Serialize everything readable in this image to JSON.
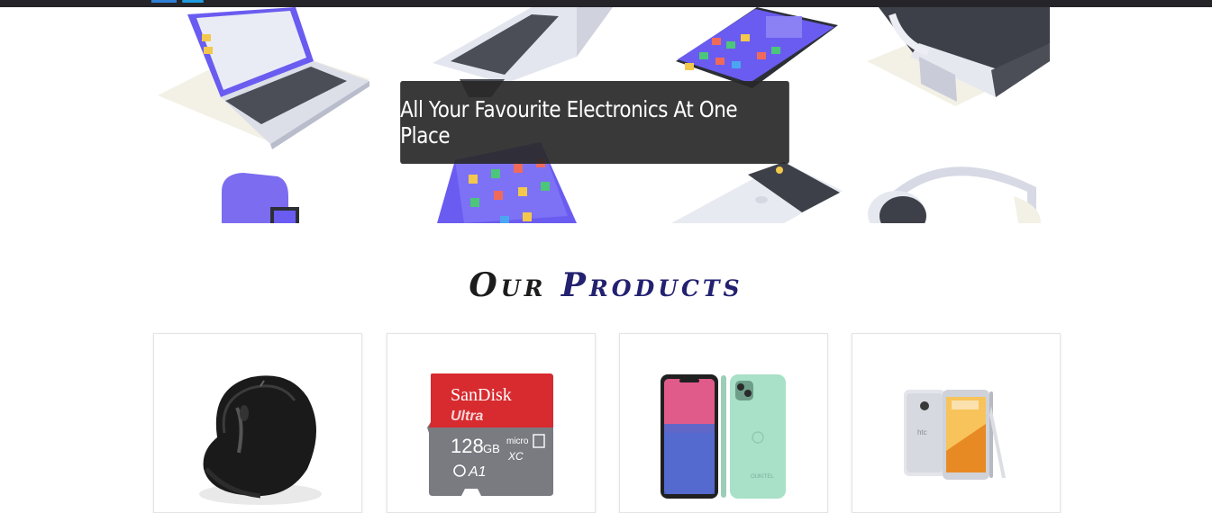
{
  "hero": {
    "caption": "All Your Favourite Electronics At One Place",
    "illustrations": [
      "laptop-icon",
      "laptop-icon",
      "smartphone-icon",
      "vr-headset-icon",
      "smartwatch-icon",
      "tablet-icon",
      "smartphone-icon",
      "headphones-icon"
    ]
  },
  "products_section": {
    "title_word1": "Our",
    "title_word2": "Products"
  },
  "products": [
    {
      "image": "wireless-mouse"
    },
    {
      "image": "sd-card",
      "brand": "SanDisk",
      "line": "Ultra",
      "capacity": "128",
      "unit": "GB",
      "class": "A1"
    },
    {
      "image": "smartphone-pair"
    },
    {
      "image": "htc-phone",
      "brand": "htc"
    }
  ],
  "colors": {
    "topbar": "#252529",
    "caption_bg": "#282828",
    "title_dark": "#1c1c1c",
    "title_accent": "#232170",
    "illustration_purple": "#7c6cf0"
  }
}
